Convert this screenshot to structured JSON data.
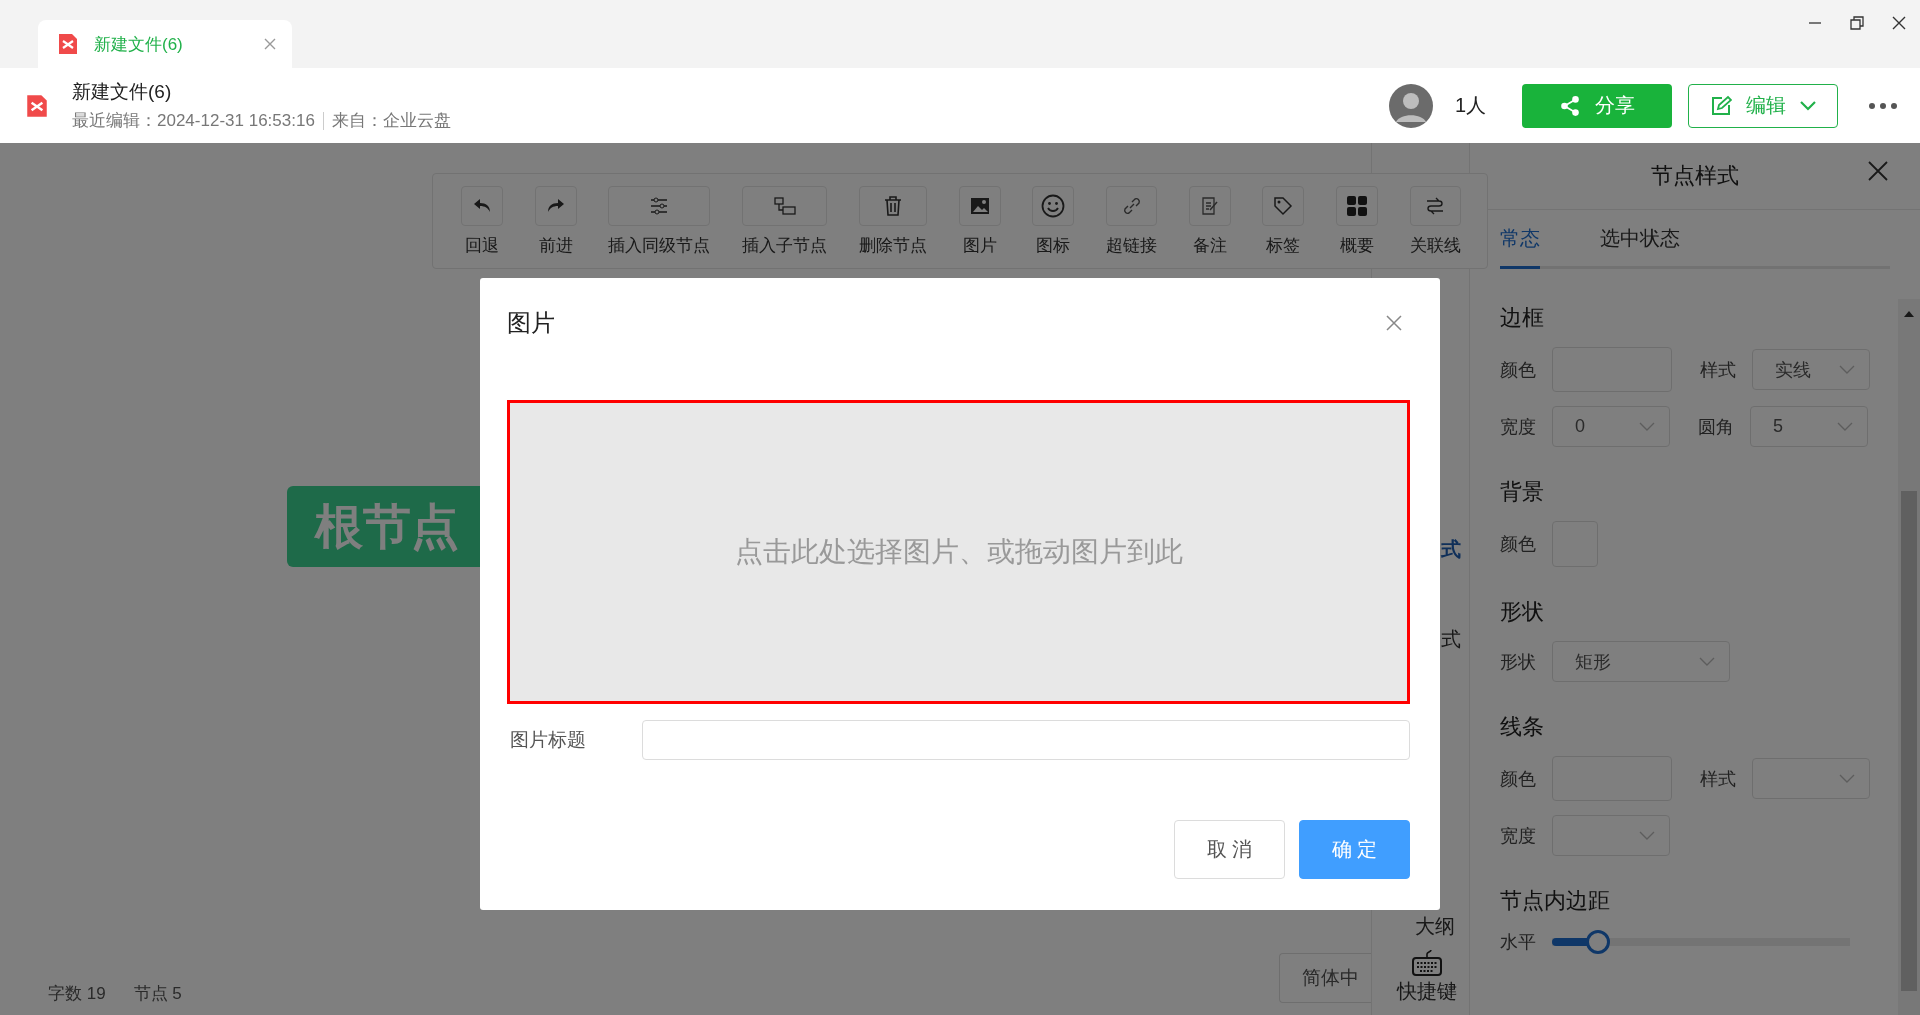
{
  "window_tab": {
    "title": "新建文件(6)",
    "selected": true
  },
  "document": {
    "title": "新建文件(6)",
    "last_edited": "最近编辑：2024-12-31 16:53:16",
    "source": "来自：企业云盘"
  },
  "collaborators": "1人",
  "header_buttons": {
    "share": "分享",
    "edit": "编辑"
  },
  "toolbar": [
    {
      "label": "回退",
      "kind": "undo"
    },
    {
      "label": "前进",
      "kind": "redo"
    },
    {
      "label": "插入同级节点",
      "kind": "sliders"
    },
    {
      "label": "插入子节点",
      "kind": "child"
    },
    {
      "label": "删除节点",
      "kind": "trash"
    },
    {
      "label": "图片",
      "kind": "image"
    },
    {
      "label": "图标",
      "kind": "smile"
    },
    {
      "label": "超链接",
      "kind": "link"
    },
    {
      "label": "备注",
      "kind": "note"
    },
    {
      "label": "标签",
      "kind": "tag"
    },
    {
      "label": "概要",
      "kind": "grid"
    },
    {
      "label": "关联线",
      "kind": "relation"
    }
  ],
  "canvas": {
    "root_node": "根节点"
  },
  "side_strip": [
    {
      "label": "式",
      "kind": "tab",
      "selected": true
    },
    {
      "label": "式",
      "kind": "tab",
      "selected": false
    },
    {
      "label": "大纲",
      "kind": "text"
    },
    {
      "label": "快捷键",
      "kind": "keyboard"
    }
  ],
  "status_bar": {
    "word_count": "字数 19",
    "node_count": "节点 5"
  },
  "language_button": "简体中",
  "panel": {
    "title": "节点样式",
    "tabs": [
      {
        "label": "常态",
        "selected": true
      },
      {
        "label": "选中状态",
        "selected": false
      }
    ],
    "sections": [
      {
        "heading": "边框",
        "rows": [
          [
            {
              "label": "颜色",
              "kind": "color"
            },
            {
              "label": "样式",
              "kind": "select",
              "value": "实线"
            }
          ],
          [
            {
              "label": "宽度",
              "kind": "select",
              "value": "0"
            },
            {
              "label": "圆角",
              "kind": "select",
              "value": "5"
            }
          ]
        ]
      },
      {
        "heading": "背景",
        "rows": [
          [
            {
              "label": "颜色",
              "kind": "swatch"
            }
          ]
        ]
      },
      {
        "heading": "形状",
        "rows": [
          [
            {
              "label": "形状",
              "kind": "wide-select",
              "value": "矩形"
            }
          ]
        ]
      },
      {
        "heading": "线条",
        "rows": [
          [
            {
              "label": "颜色",
              "kind": "color"
            },
            {
              "label": "样式",
              "kind": "select"
            }
          ],
          [
            {
              "label": "宽度",
              "kind": "select"
            }
          ]
        ]
      },
      {
        "heading": "节点内边距",
        "rows": [
          [
            {
              "label": "水平",
              "kind": "slider",
              "level": 0.15
            }
          ]
        ]
      }
    ]
  },
  "dialog": {
    "title": "图片",
    "drop_hint": "点击此处选择图片、或拖动图片到此",
    "caption_label": "图片标题",
    "buttons": [
      {
        "label": "取 消",
        "kind": "secondary"
      },
      {
        "label": "确 定",
        "kind": "primary"
      }
    ]
  }
}
